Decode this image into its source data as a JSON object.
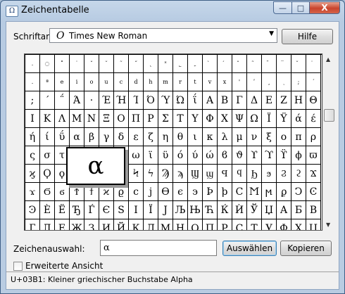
{
  "window": {
    "title": "Zeichentabelle",
    "icon": "charmap-icon",
    "buttons": {
      "minimize": "—",
      "maximize": "□",
      "close": "X"
    }
  },
  "font": {
    "label": "Schriftart:",
    "value": "Times New Roman",
    "help_label": "Hilfe"
  },
  "grid": {
    "rows": [
      [
        ".",
        "◌",
        "˚",
        "˙",
        "ˇ",
        "˘",
        "˜",
        "˝",
        "˛",
        "˟",
        "˾",
        "˿",
        "̀",
        "́",
        "̂",
        "̃",
        "̄",
        "̅",
        "̆",
        "̇"
      ],
      [
        ".",
        "ª",
        "e",
        "i",
        "o",
        "u",
        "c",
        "d",
        "h",
        "m",
        "r",
        "t",
        "v",
        "x",
        "'",
        "ʹ",
        "͵",
        "ͺ",
        ";",
        "΄"
      ],
      [
        ";",
        "΄",
        "΅",
        "Ά",
        "·",
        "Έ",
        "Ή",
        "Ί",
        "Ό",
        "Ύ",
        "Ώ",
        "ΐ",
        "Α",
        "Β",
        "Γ",
        "Δ",
        "Ε",
        "Ζ",
        "Η",
        "Θ"
      ],
      [
        "Ι",
        "Κ",
        "Λ",
        "Μ",
        "Ν",
        "Ξ",
        "Ο",
        "Π",
        "Ρ",
        "Σ",
        "Τ",
        "Υ",
        "Φ",
        "Χ",
        "Ψ",
        "Ω",
        "Ϊ",
        "Ϋ",
        "ά",
        "έ"
      ],
      [
        "ή",
        "ί",
        "ΰ",
        "α",
        "β",
        "γ",
        "δ",
        "ε",
        "ζ",
        "η",
        "θ",
        "ι",
        "κ",
        "λ",
        "μ",
        "ν",
        "ξ",
        "ο",
        "π",
        "ρ"
      ],
      [
        "ς",
        "σ",
        "τ",
        "υ",
        "φ",
        "χ",
        "ψ",
        "ω",
        "ϊ",
        "ϋ",
        "ό",
        "ύ",
        "ώ",
        "ϐ",
        "ϑ",
        "ϒ",
        "ϓ",
        "ϔ",
        "ϕ",
        "ϖ"
      ],
      [
        "ϗ",
        "Ϙ",
        "ϙ",
        "Ϛ",
        "ϛ",
        "Ϝ",
        "ϝ",
        "Ϟ",
        "ϟ",
        "Ϡ",
        "ϡ",
        "Ϣ",
        "ϣ",
        "Ϥ",
        "ϥ",
        "Ϧ",
        "ϧ",
        "Ϩ",
        "ϩ",
        "Ϫ"
      ],
      [
        "ϫ",
        "Ϭ",
        "ϭ",
        "Ϯ",
        "ϯ",
        "ϰ",
        "ϱ",
        "ϲ",
        "ϳ",
        "ϴ",
        "ϵ",
        "϶",
        "Ϸ",
        "ϸ",
        "Ϲ",
        "Ϻ",
        "ϻ",
        "ϼ",
        "Ͻ",
        "Ͼ"
      ],
      [
        "Ͽ",
        "Ѐ",
        "Ё",
        "Ђ",
        "Ѓ",
        "Є",
        "Ѕ",
        "І",
        "Ї",
        "Ј",
        "Љ",
        "Њ",
        "Ћ",
        "Ќ",
        "Ѝ",
        "Ў",
        "Џ",
        "А",
        "Б",
        "В"
      ],
      [
        "Г",
        "Д",
        "Е",
        "Ж",
        "З",
        "И",
        "Й",
        "К",
        "Л",
        "М",
        "Н",
        "О",
        "П",
        "Р",
        "С",
        "Т",
        "У",
        "Ф",
        "Х",
        "Ц"
      ]
    ],
    "zoom_char": "α"
  },
  "selection": {
    "label": "Zeichenauswahl:",
    "value": "α",
    "select_button": "Auswählen",
    "copy_button": "Kopieren"
  },
  "advanced": {
    "label": "Erweiterte Ansicht",
    "checked": false
  },
  "status": {
    "text": "U+03B1: Kleiner griechischer Buchstabe Alpha"
  }
}
